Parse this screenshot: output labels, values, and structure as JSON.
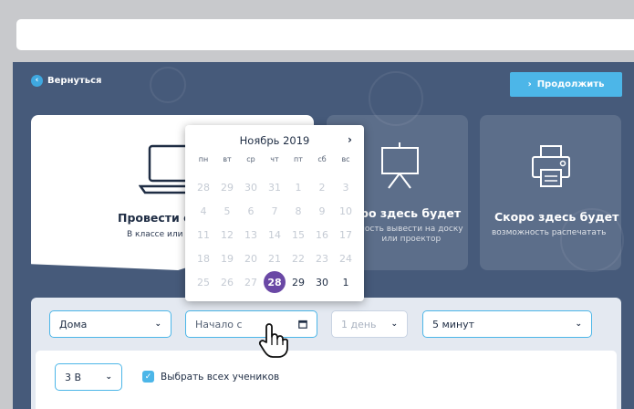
{
  "nav": {
    "back_label": "Вернуться",
    "continue_label": "Продолжить"
  },
  "cards": [
    {
      "title": "Провести с",
      "subtitle": "В классе или"
    },
    {
      "title": "ро здесь будет",
      "subtitle_line1": "ность вывести на доску",
      "subtitle_line2": "или проектор"
    },
    {
      "title": "Скоро здесь будет",
      "subtitle": "возможность распечатать"
    }
  ],
  "filters": {
    "location": "Дома",
    "start_placeholder": "Начало с",
    "duration": "1 день",
    "interval": "5 минут",
    "class": "3 В",
    "select_all_label": "Выбрать всех учеников"
  },
  "calendar": {
    "month_title": "Ноябрь 2019",
    "weekdays": [
      "пн",
      "вт",
      "ср",
      "чт",
      "пт",
      "сб",
      "вс"
    ],
    "days": [
      {
        "d": "28",
        "active": false
      },
      {
        "d": "29",
        "active": false
      },
      {
        "d": "30",
        "active": false
      },
      {
        "d": "31",
        "active": false
      },
      {
        "d": "1",
        "active": false
      },
      {
        "d": "2",
        "active": false
      },
      {
        "d": "3",
        "active": false
      },
      {
        "d": "4",
        "active": false
      },
      {
        "d": "5",
        "active": false
      },
      {
        "d": "6",
        "active": false
      },
      {
        "d": "7",
        "active": false
      },
      {
        "d": "8",
        "active": false
      },
      {
        "d": "9",
        "active": false
      },
      {
        "d": "10",
        "active": false
      },
      {
        "d": "11",
        "active": false
      },
      {
        "d": "12",
        "active": false
      },
      {
        "d": "13",
        "active": false
      },
      {
        "d": "14",
        "active": false
      },
      {
        "d": "15",
        "active": false
      },
      {
        "d": "16",
        "active": false
      },
      {
        "d": "17",
        "active": false
      },
      {
        "d": "18",
        "active": false
      },
      {
        "d": "19",
        "active": false
      },
      {
        "d": "20",
        "active": false
      },
      {
        "d": "21",
        "active": false
      },
      {
        "d": "22",
        "active": false
      },
      {
        "d": "23",
        "active": false
      },
      {
        "d": "24",
        "active": false
      },
      {
        "d": "25",
        "active": false
      },
      {
        "d": "26",
        "active": false
      },
      {
        "d": "27",
        "active": false
      },
      {
        "d": "28",
        "active": true,
        "selected": true
      },
      {
        "d": "29",
        "active": true
      },
      {
        "d": "30",
        "active": true
      },
      {
        "d": "1",
        "active": true
      }
    ]
  },
  "colors": {
    "background": "#465a7a",
    "accent": "#4cb6e8",
    "selected_day": "#6a48a5"
  },
  "icons": {
    "back": "chevron-left-icon",
    "continue": "chevron-right-icon",
    "laptop": "laptop-icon",
    "projector": "projector-board-icon",
    "printer": "printer-icon",
    "calendar": "calendar-icon",
    "cursor": "hand-pointer-icon"
  }
}
